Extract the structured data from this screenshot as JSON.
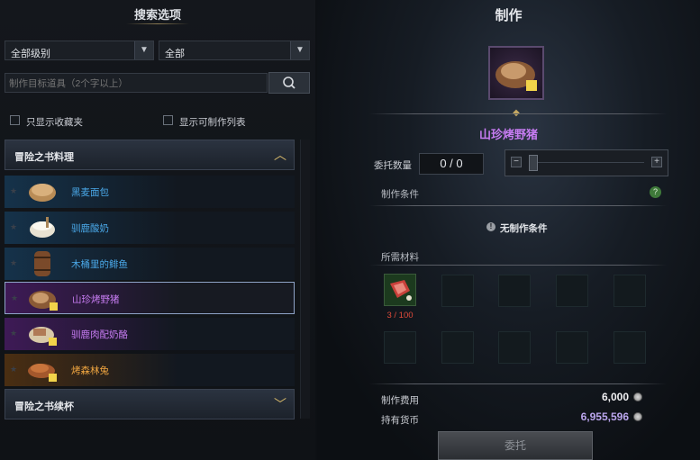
{
  "left_panel": {
    "title": "搜索选项",
    "grade_select": "全部级别",
    "type_select": "全部",
    "search_placeholder": "制作目标道具（2个字以上）",
    "checkbox_favorites": "只显示收藏夹",
    "checkbox_craftable": "显示可制作列表",
    "category_open": "冒险之书料理",
    "items": [
      {
        "name": "黑麦面包",
        "color": "#4aa8e8"
      },
      {
        "name": "驯鹿酸奶",
        "color": "#4aa8e8"
      },
      {
        "name": "木桶里的鲱鱼",
        "color": "#4aa8e8"
      },
      {
        "name": "山珍烤野猪",
        "color": "#c77cf2"
      },
      {
        "name": "驯鹿肉配奶酪",
        "color": "#c77cf2"
      },
      {
        "name": "烤森林兔",
        "color": "#f0a640"
      }
    ],
    "category_closed": "冒险之书续杯"
  },
  "right_panel": {
    "title": "制作",
    "item_name": "山珍烤野猪",
    "quantity_label": "委托数量",
    "quantity_value": "0 / 0",
    "conditions_label": "制作条件",
    "no_conditions": "无制作条件",
    "materials_label": "所需材料",
    "material_count": "3 / 100",
    "cost_label": "制作费用",
    "cost_value": "6,000",
    "currency_label": "持有货币",
    "currency_value": "6,955,596",
    "craft_button": "委托"
  },
  "colors": {
    "blue_item": "#4aa8e8",
    "purple_item": "#c77cf2",
    "orange_item": "#f0a640",
    "gold_accent": "#d6b86a"
  }
}
